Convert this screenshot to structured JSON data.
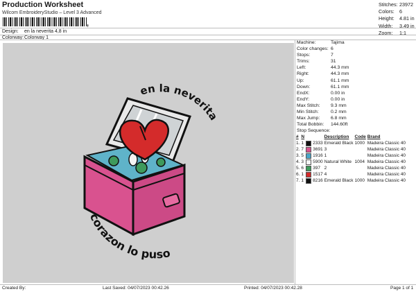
{
  "header": {
    "title": "Production Worksheet",
    "subtitle": "Wilcom EmbroideryStudio – Level 3 Advanced",
    "barcode_mark": ",",
    "design_label": "Design:",
    "design_value": "en la neverita 4,8 in",
    "colorway_label": "Colorway:",
    "colorway_value": "Colorway 1"
  },
  "stats": [
    {
      "label": "Stitches:",
      "value": "23972"
    },
    {
      "label": "Colors:",
      "value": "6"
    },
    {
      "label": "Height:",
      "value": "4.81 in"
    },
    {
      "label": "Width:",
      "value": "3.49 in"
    },
    {
      "label": "Zoom:",
      "value": "1:1"
    }
  ],
  "design_text": {
    "top": "en la neverita",
    "bottom": "el corazon lo puso"
  },
  "properties": [
    {
      "label": "Machine:",
      "value": "Tajima"
    },
    {
      "label": "Color changes:",
      "value": "6"
    },
    {
      "label": "Stops:",
      "value": "7"
    },
    {
      "label": "Trims:",
      "value": "31"
    },
    {
      "label": "Left:",
      "value": "44.3 mm"
    },
    {
      "label": "Right:",
      "value": "44.3 mm"
    },
    {
      "label": "Up:",
      "value": "61.1 mm"
    },
    {
      "label": "Down:",
      "value": "61.1 mm"
    },
    {
      "label": "EndX:",
      "value": "0.00 in"
    },
    {
      "label": "EndY:",
      "value": "0.00 in"
    },
    {
      "label": "Max Stitch:",
      "value": "9.3 mm"
    },
    {
      "label": "Min Stitch:",
      "value": "0.2 mm"
    },
    {
      "label": "Max Jump:",
      "value": "6.8 mm"
    },
    {
      "label": "Total Bobbin:",
      "value": "144.60ft"
    }
  ],
  "stop_sequence": {
    "title": "Stop Sequence:",
    "columns": [
      "#",
      "N",
      "Description",
      "Code",
      "Brand"
    ],
    "rows": [
      {
        "num": "1.",
        "n": "1",
        "color": "#111111",
        "code_id": "2333",
        "description": "Emerald Black",
        "code": "1000",
        "brand": "Madeira Classic 40"
      },
      {
        "num": "2.",
        "n": "7",
        "color": "#d9528f",
        "code_id": "3691",
        "description": "3",
        "code": "",
        "brand": "Madeira Classic 40"
      },
      {
        "num": "3.",
        "n": "5",
        "color": "#4aa6c9",
        "code_id": "1916",
        "description": "1",
        "code": "",
        "brand": "Madeira Classic 40"
      },
      {
        "num": "4.",
        "n": "3",
        "color": "#f4f4f4",
        "code_id": "5900",
        "description": "Natural White",
        "code": "1004",
        "brand": "Madeira Classic 40"
      },
      {
        "num": "5.",
        "n": "6",
        "color": "#3e9a5c",
        "code_id": "397",
        "description": "2",
        "code": "",
        "brand": "Madeira Classic 40"
      },
      {
        "num": "6.",
        "n": "1",
        "color": "#d42b2b",
        "code_id": "1517",
        "description": "4",
        "code": "",
        "brand": "Madeira Classic 40"
      },
      {
        "num": "7.",
        "n": "1",
        "color": "#111111",
        "code_id": "8216",
        "description": "Emerald Black",
        "code": "1000",
        "brand": "Madeira Classic 40"
      }
    ]
  },
  "footer": {
    "created_by": "Created By:",
    "last_saved": "Last Saved: 04/07/2023 00:42.26",
    "printed": "Printed: 04/07/2023 00:42.28",
    "page": "Page 1 of 1"
  }
}
